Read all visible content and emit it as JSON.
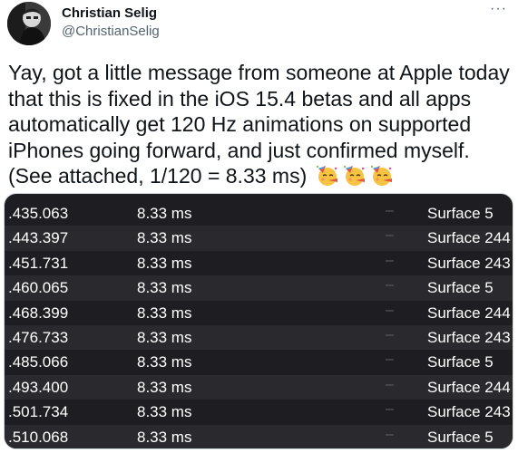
{
  "author": {
    "name": "Christian Selig",
    "handle": "@ChristianSelig"
  },
  "more_label": "···",
  "tweet": {
    "text": "Yay, got a little message from someone at Apple today that this is fixed in the iOS 15.4 betas and all apps automatically get 120 Hz animations on supported iPhones going forward, and just confirmed myself. (See attached, 1/120 = 8.33 ms)",
    "emoji": [
      "partying-face-emoji",
      "partying-face-emoji",
      "partying-face-emoji"
    ]
  },
  "media": {
    "rows": [
      {
        "time": ".435.063",
        "duration": "8.33 ms",
        "dash": "–",
        "surface": "Surface 5"
      },
      {
        "time": ".443.397",
        "duration": "8.33 ms",
        "dash": "–",
        "surface": "Surface 244"
      },
      {
        "time": ".451.731",
        "duration": "8.33 ms",
        "dash": "–",
        "surface": "Surface 243"
      },
      {
        "time": ".460.065",
        "duration": "8.33 ms",
        "dash": "–",
        "surface": "Surface 5"
      },
      {
        "time": ".468.399",
        "duration": "8.33 ms",
        "dash": "–",
        "surface": "Surface 244"
      },
      {
        "time": ".476.733",
        "duration": "8.33 ms",
        "dash": "–",
        "surface": "Surface 243"
      },
      {
        "time": ".485.066",
        "duration": "8.33 ms",
        "dash": "–",
        "surface": "Surface 5"
      },
      {
        "time": ".493.400",
        "duration": "8.33 ms",
        "dash": "–",
        "surface": "Surface 244"
      },
      {
        "time": ".501.734",
        "duration": "8.33 ms",
        "dash": "–",
        "surface": "Surface 243"
      },
      {
        "time": ".510.068",
        "duration": "8.33 ms",
        "dash": "–",
        "surface": "Surface 5"
      }
    ]
  },
  "colors": {
    "text": "#0f1419",
    "secondary": "#536471",
    "media_bg": "#1e1e22",
    "media_row_alt": "#2a2a2e"
  }
}
